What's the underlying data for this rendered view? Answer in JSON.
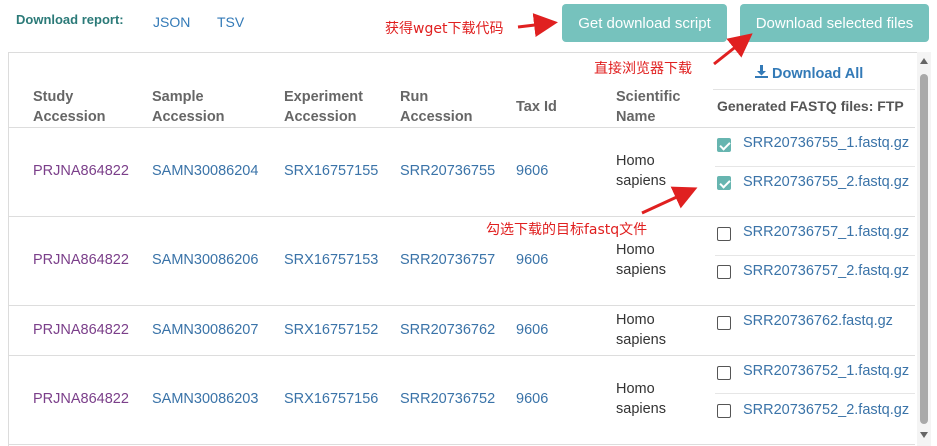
{
  "report": {
    "label": "Download report:",
    "json_link": "JSON",
    "tsv_link": "TSV"
  },
  "buttons": {
    "get_script": "Get download script",
    "download_selected": "Download selected files"
  },
  "download_all": "Download All",
  "headers": {
    "study": [
      "Study",
      "Accession"
    ],
    "sample": [
      "Sample",
      "Accession"
    ],
    "experiment": [
      "Experiment",
      "Accession"
    ],
    "run": [
      "Run",
      "Accession"
    ],
    "tax": "Tax Id",
    "sci": [
      "Scientific",
      "Name"
    ],
    "ftp": "Generated FASTQ files: FTP"
  },
  "rows": [
    {
      "study": "PRJNA864822",
      "sample": "SAMN30086204",
      "experiment": "SRX16757155",
      "run": "SRR20736755",
      "tax": "9606",
      "sci": [
        "Homo",
        "sapiens"
      ],
      "files": [
        {
          "name": "SRR20736755_1.fastq.gz",
          "checked": true
        },
        {
          "name": "SRR20736755_2.fastq.gz",
          "checked": true
        }
      ]
    },
    {
      "study": "PRJNA864822",
      "sample": "SAMN30086206",
      "experiment": "SRX16757153",
      "run": "SRR20736757",
      "tax": "9606",
      "sci": [
        "Homo",
        "sapiens"
      ],
      "files": [
        {
          "name": "SRR20736757_1.fastq.gz",
          "checked": false
        },
        {
          "name": "SRR20736757_2.fastq.gz",
          "checked": false
        }
      ]
    },
    {
      "study": "PRJNA864822",
      "sample": "SAMN30086207",
      "experiment": "SRX16757152",
      "run": "SRR20736762",
      "tax": "9606",
      "sci": [
        "Homo",
        "sapiens"
      ],
      "files": [
        {
          "name": "SRR20736762.fastq.gz",
          "checked": false
        }
      ]
    },
    {
      "study": "PRJNA864822",
      "sample": "SAMN30086203",
      "experiment": "SRX16757156",
      "run": "SRR20736752",
      "tax": "9606",
      "sci": [
        "Homo",
        "sapiens"
      ],
      "files": [
        {
          "name": "SRR20736752_1.fastq.gz",
          "checked": false
        },
        {
          "name": "SRR20736752_2.fastq.gz",
          "checked": false
        }
      ]
    }
  ],
  "annotations": {
    "wget": "获得wget下载代码",
    "browser": "直接浏览器下载",
    "select": "勾选下载的目标fastq文件"
  },
  "colors": {
    "button": "#76c2bd",
    "accent_link": "#3a73a8",
    "study_link": "#7b3f8a",
    "annotation": "#e02020"
  }
}
